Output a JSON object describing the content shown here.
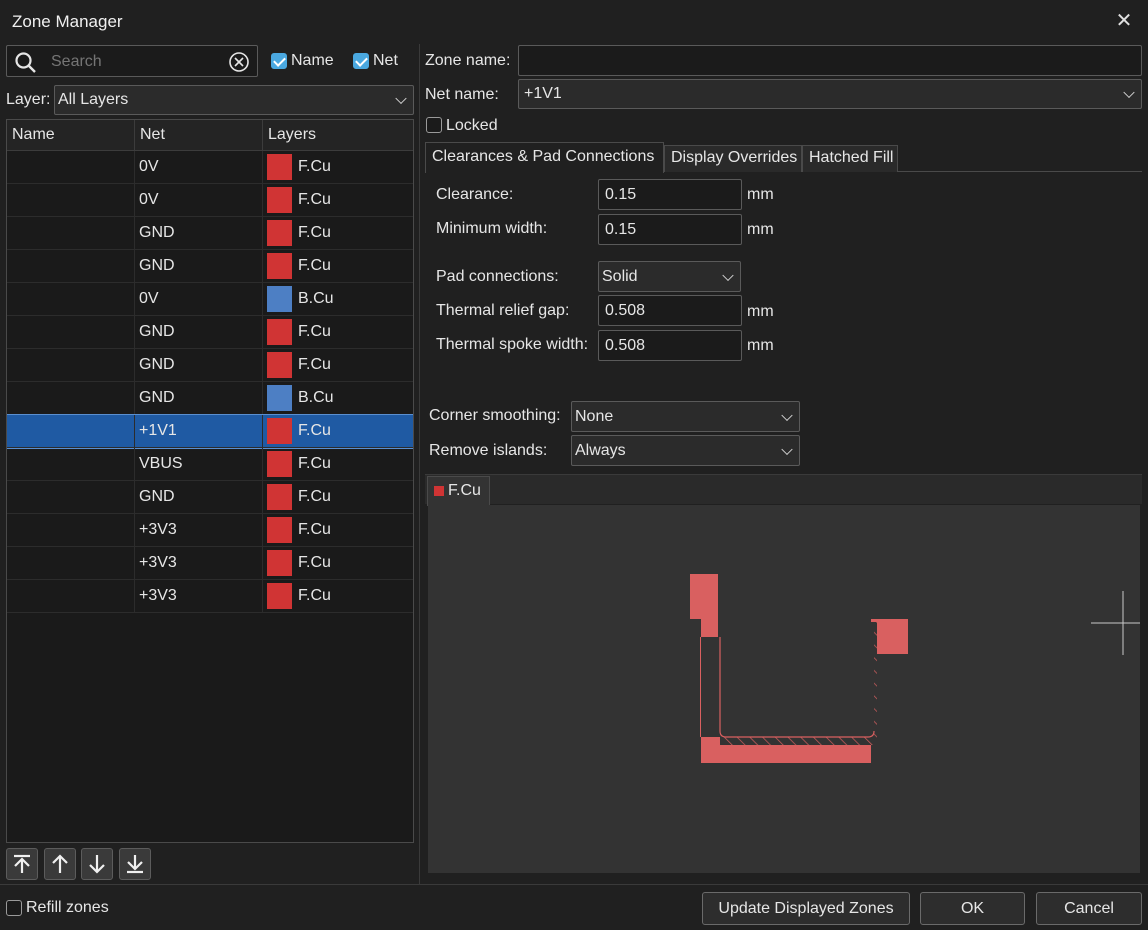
{
  "window": {
    "title": "Zone Manager"
  },
  "search": {
    "placeholder": "Search"
  },
  "filters": {
    "name_label": "Name",
    "net_label": "Net",
    "name_checked": true,
    "net_checked": true
  },
  "layer_filter": {
    "label": "Layer:",
    "value": "All Layers"
  },
  "table": {
    "columns": [
      "Name",
      "Net",
      "Layers"
    ],
    "rows": [
      {
        "name": "",
        "net": "0V",
        "layer": "F.Cu",
        "color": "#d03434"
      },
      {
        "name": "",
        "net": "0V",
        "layer": "F.Cu",
        "color": "#d03434"
      },
      {
        "name": "",
        "net": "GND",
        "layer": "F.Cu",
        "color": "#d03434"
      },
      {
        "name": "",
        "net": "GND",
        "layer": "F.Cu",
        "color": "#d03434"
      },
      {
        "name": "",
        "net": "0V",
        "layer": "B.Cu",
        "color": "#4d7fc4"
      },
      {
        "name": "",
        "net": "GND",
        "layer": "F.Cu",
        "color": "#d03434"
      },
      {
        "name": "",
        "net": "GND",
        "layer": "F.Cu",
        "color": "#d03434"
      },
      {
        "name": "",
        "net": "GND",
        "layer": "B.Cu",
        "color": "#4d7fc4"
      },
      {
        "name": "",
        "net": "+1V1",
        "layer": "F.Cu",
        "color": "#d03434",
        "selected": true
      },
      {
        "name": "",
        "net": "VBUS",
        "layer": "F.Cu",
        "color": "#d03434"
      },
      {
        "name": "",
        "net": "GND",
        "layer": "F.Cu",
        "color": "#d03434"
      },
      {
        "name": "",
        "net": "+3V3",
        "layer": "F.Cu",
        "color": "#d03434"
      },
      {
        "name": "",
        "net": "+3V3",
        "layer": "F.Cu",
        "color": "#d03434"
      },
      {
        "name": "",
        "net": "+3V3",
        "layer": "F.Cu",
        "color": "#d03434"
      }
    ]
  },
  "move_buttons": [
    "move-to-top-icon",
    "move-up-icon",
    "move-down-icon",
    "move-to-bottom-icon"
  ],
  "props": {
    "zone_name_label": "Zone name:",
    "zone_name_value": "",
    "net_name_label": "Net name:",
    "net_name_value": "+1V1",
    "locked_label": "Locked",
    "locked_checked": false
  },
  "tabs": [
    "Clearances & Pad Connections",
    "Display Overrides",
    "Hatched Fill"
  ],
  "clearances": {
    "clearance_label": "Clearance:",
    "clearance_value": "0.15",
    "clearance_unit": "mm",
    "min_width_label": "Minimum width:",
    "min_width_value": "0.15",
    "min_width_unit": "mm",
    "pad_conn_label": "Pad connections:",
    "pad_conn_value": "Solid",
    "relief_gap_label": "Thermal relief gap:",
    "relief_gap_value": "0.508",
    "relief_gap_unit": "mm",
    "spoke_width_label": "Thermal spoke width:",
    "spoke_width_value": "0.508",
    "spoke_width_unit": "mm"
  },
  "corner": {
    "label": "Corner smoothing:",
    "value": "None"
  },
  "islands": {
    "label": "Remove islands:",
    "value": "Always"
  },
  "preview": {
    "tab_label": "F.Cu",
    "tab_color": "#d03434",
    "zone_color": "#d96060"
  },
  "footer": {
    "refill_label": "Refill zones",
    "refill_checked": false,
    "update_label": "Update Displayed Zones",
    "ok_label": "OK",
    "cancel_label": "Cancel"
  }
}
